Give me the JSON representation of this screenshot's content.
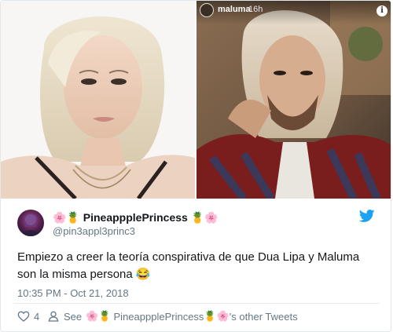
{
  "media": {
    "right_overlay": {
      "username": "maluma",
      "time": "16h",
      "info_glyph": "i"
    }
  },
  "tweet": {
    "display_name_prefix": "🌸🍍",
    "display_name": "PineappplePrincess",
    "display_name_suffix": "🍍🌸",
    "handle": "@pin3appl3princ3",
    "text": "Empiezo a creer la teoría conspirativa de que Dua Lipa y Maluma son la misma persona 😂",
    "timestamp": "10:35 PM - Oct 21, 2018",
    "like_count": "4",
    "see_label": "See",
    "others_name_prefix": "🌸🍍",
    "others_name": "PineappplePrincess",
    "others_name_suffix": "🍍🌸",
    "others_suffix": "'s other Tweets"
  },
  "colors": {
    "text": "#14171a",
    "secondary": "#657786",
    "twitter_blue": "#1da1f2",
    "divider": "#e6ecf0"
  },
  "icons": {
    "brand": "twitter-bird-icon",
    "like": "heart-outline-icon",
    "profile": "person-icon",
    "info": "info-icon"
  }
}
